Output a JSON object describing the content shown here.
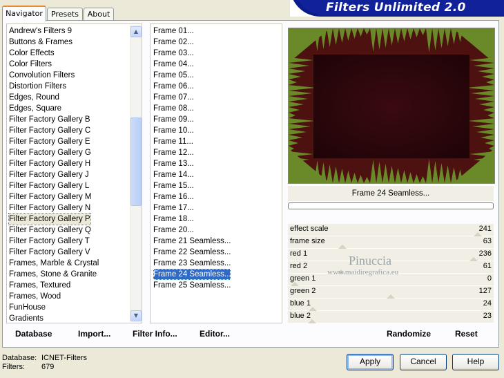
{
  "tabs": [
    {
      "label": "Navigator",
      "active": true
    },
    {
      "label": "Presets",
      "active": false
    },
    {
      "label": "About",
      "active": false
    }
  ],
  "banner_title": "Filters Unlimited 2.0",
  "categories": [
    "Andrew's Filters 9",
    "Buttons & Frames",
    "Color Effects",
    "Color Filters",
    "Convolution Filters",
    "Distortion Filters",
    "Edges, Round",
    "Edges, Square",
    "Filter Factory Gallery B",
    "Filter Factory Gallery C",
    "Filter Factory Gallery E",
    "Filter Factory Gallery G",
    "Filter Factory Gallery H",
    "Filter Factory Gallery J",
    "Filter Factory Gallery L",
    "Filter Factory Gallery M",
    "Filter Factory Gallery N",
    "Filter Factory Gallery P",
    "Filter Factory Gallery Q",
    "Filter Factory Gallery T",
    "Filter Factory Gallery V",
    "Frames, Marble & Crystal",
    "Frames, Stone & Granite",
    "Frames, Textured",
    "Frames, Wood",
    "FunHouse",
    "Gradients"
  ],
  "selected_category": "Filter Factory Gallery P",
  "filters": [
    "Frame 01...",
    "Frame 02...",
    "Frame 03...",
    "Frame 04...",
    "Frame 05...",
    "Frame 06...",
    "Frame 07...",
    "Frame 08...",
    "Frame 09...",
    "Frame 10...",
    "Frame 11...",
    "Frame 12...",
    "Frame 13...",
    "Frame 14...",
    "Frame 15...",
    "Frame 16...",
    "Frame 17...",
    "Frame 18...",
    "Frame 20...",
    "Frame 21 Seamless...",
    "Frame 22 Seamless...",
    "Frame 23 Seamless...",
    "Frame 24 Seamless...",
    "Frame 25 Seamless..."
  ],
  "selected_filter": "Frame 24 Seamless...",
  "preview_caption": "Frame 24 Seamless...",
  "params": [
    {
      "label": "effect scale",
      "value": "241",
      "level": 0.945
    },
    {
      "label": "frame size",
      "value": "63",
      "level": 0.247
    },
    {
      "label": "red 1",
      "value": "236",
      "level": 0.925
    },
    {
      "label": "red 2",
      "value": "61",
      "level": 0.239
    },
    {
      "label": "green 1",
      "value": "0",
      "level": 0.0
    },
    {
      "label": "green 2",
      "value": "127",
      "level": 0.498
    },
    {
      "label": "blue 1",
      "value": "24",
      "level": 0.094
    },
    {
      "label": "blue 2",
      "value": "23",
      "level": 0.09
    }
  ],
  "left_buttons": {
    "database": "Database",
    "import": "Import...",
    "filter_info": "Filter Info...",
    "editor": "Editor..."
  },
  "right_buttons": {
    "randomize": "Randomize",
    "reset": "Reset"
  },
  "status": {
    "database_label": "Database:",
    "database_value": "ICNET-Filters",
    "filters_label": "Filters:",
    "filters_value": "679"
  },
  "dialog_buttons": {
    "apply": "Apply",
    "cancel": "Cancel",
    "help": "Help"
  },
  "watermark": {
    "name": "Pinuccia",
    "site": "www.maidiregrafica.eu"
  },
  "colors": {
    "selection": "#316ac5",
    "preview_green": "#6a8a2a",
    "preview_dark": "#3b0c0e",
    "banner_blue": "#0c1b8c"
  }
}
